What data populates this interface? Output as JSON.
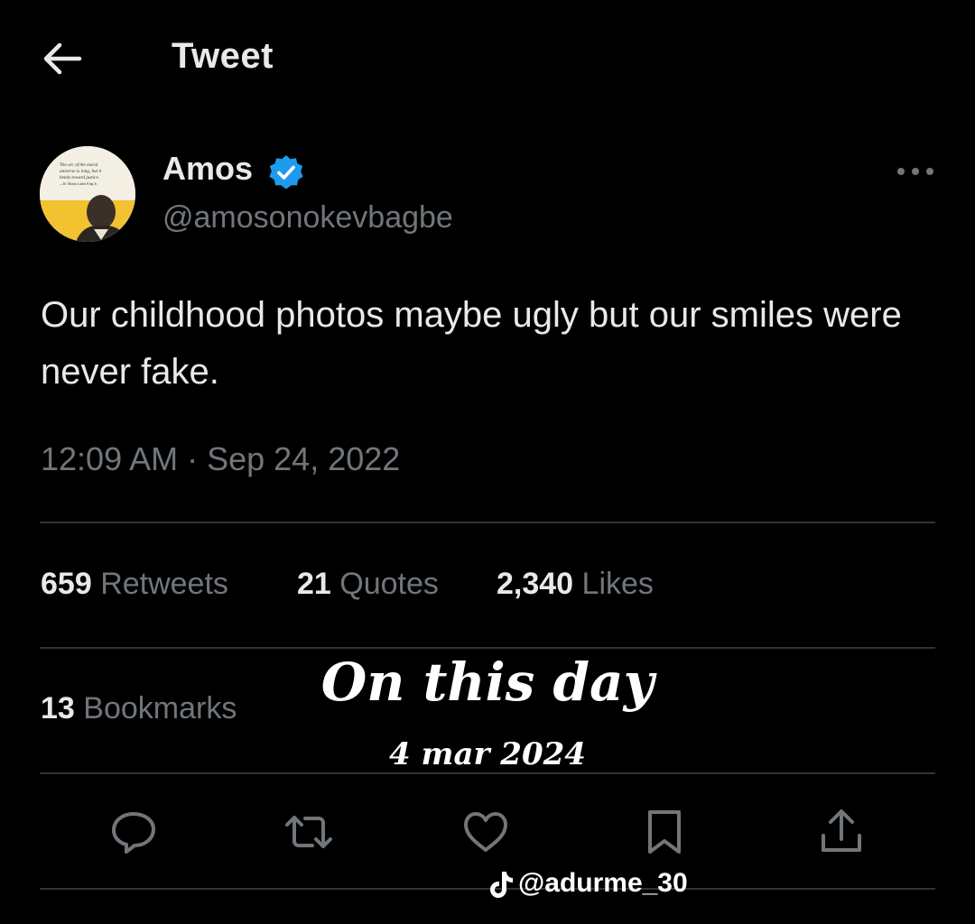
{
  "header": {
    "title": "Tweet",
    "back_icon": "arrow-left-icon"
  },
  "author": {
    "display_name": "Amos",
    "handle": "@amosonokevbagbe",
    "verified": true,
    "verified_color": "#1d9bf0",
    "avatar_quote": [
      "The arc of the moral",
      "universe is long, but it",
      "bends toward justice.",
      "—Dr. Martin Luther King Jr."
    ]
  },
  "tweet": {
    "text": "Our childhood photos maybe ugly but our smiles were never fake.",
    "timestamp": "12:09 AM · Sep 24, 2022"
  },
  "stats": [
    {
      "count": "659",
      "label": "Retweets"
    },
    {
      "count": "21",
      "label": "Quotes"
    },
    {
      "count": "2,340",
      "label": "Likes"
    }
  ],
  "bookmarks": {
    "count": "13",
    "label": "Bookmarks"
  },
  "overlay": {
    "title": "On this day",
    "date": "4 mar 2024"
  },
  "actions": [
    {
      "name": "reply",
      "icon": "reply-icon"
    },
    {
      "name": "retweet",
      "icon": "retweet-icon"
    },
    {
      "name": "like",
      "icon": "heart-icon"
    },
    {
      "name": "bookmark",
      "icon": "bookmark-icon"
    },
    {
      "name": "share",
      "icon": "share-icon"
    }
  ],
  "watermark": {
    "text": "@adurme_30",
    "icon": "tiktok-icon"
  },
  "colors": {
    "background": "#000000",
    "text_primary": "#e7e9ea",
    "text_secondary": "#71767b",
    "divider": "#2f3336"
  }
}
